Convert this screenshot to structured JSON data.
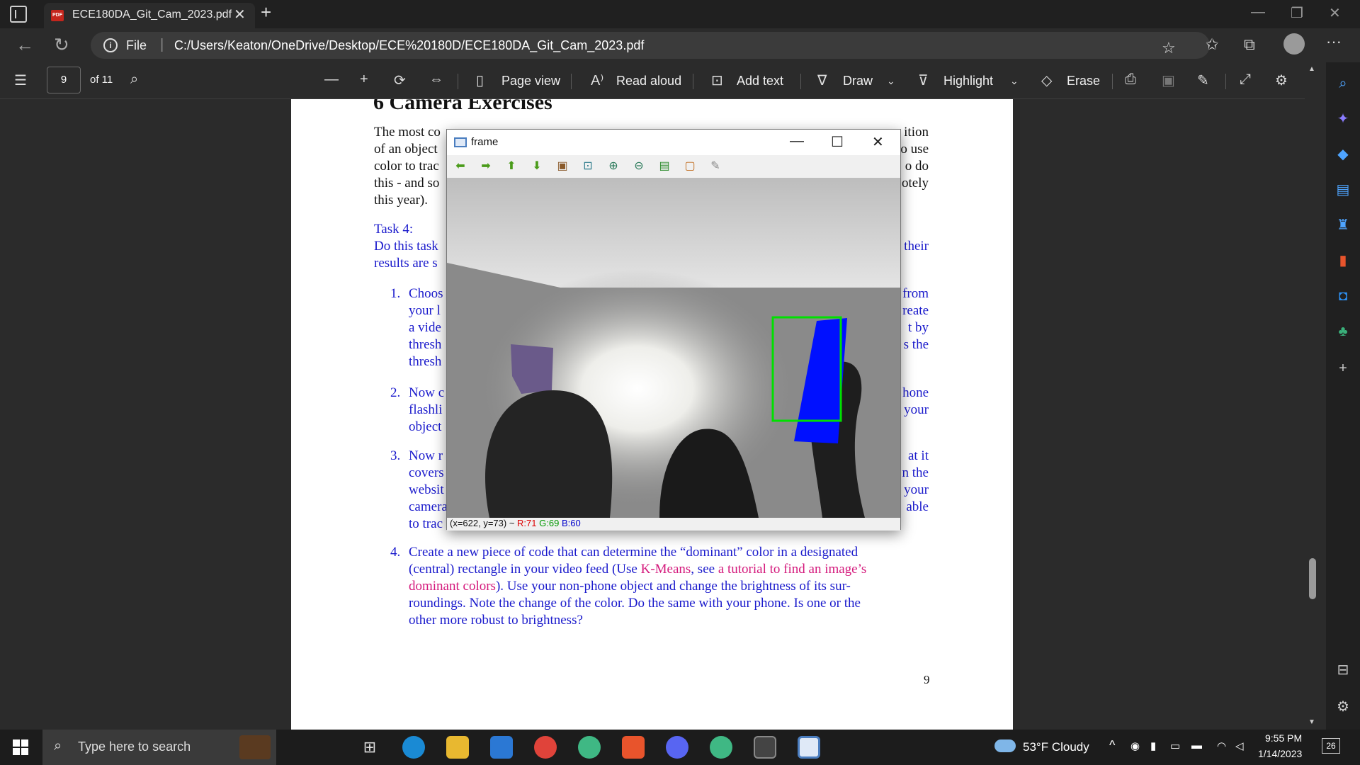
{
  "browser": {
    "tab_title": "ECE180DA_Git_Cam_2023.pdf",
    "pdf_badge": "PDF",
    "file_label": "File",
    "url": "C:/Users/Keaton/OneDrive/Desktop/ECE%20180D/ECE180DA_Git_Cam_2023.pdf"
  },
  "pdf_toolbar": {
    "page_number": "9",
    "page_total": "of 11",
    "page_view": "Page view",
    "read_aloud": "Read aloud",
    "add_text": "Add text",
    "draw": "Draw",
    "highlight": "Highlight",
    "erase": "Erase"
  },
  "pdf_page": {
    "section_title": "6   Camera Exercises",
    "intro_left": [
      "The most co",
      "of an object",
      "color to trac",
      "this - and so",
      "this year)."
    ],
    "intro_right": [
      "ition",
      "o use",
      "o do",
      "otely"
    ],
    "task_label": "Task 4:",
    "task_left": [
      "Do this task",
      "results are s"
    ],
    "task_right": [
      "their"
    ],
    "item1_num": "1.",
    "item1_left": [
      "Choos",
      "your l",
      "a vide",
      "thresh",
      "thresh"
    ],
    "item1_right": [
      "from",
      "reate",
      "t by",
      "s the"
    ],
    "item2_num": "2.",
    "item2_left": [
      "Now c",
      "flashli",
      "object"
    ],
    "item2_right": [
      "hone",
      "your"
    ],
    "item3_num": "3.",
    "item3_left": [
      "Now r",
      "covers",
      "websit",
      "camera",
      "to trac"
    ],
    "item3_right": [
      "at it",
      "n the",
      "your",
      "able"
    ],
    "item4_num": "4.",
    "item4_line1": "Create a new piece of code that can determine the “dominant” color in a designated",
    "item4_line2a": "(central) rectangle in your video feed (Use ",
    "item4_link1": "K-Means",
    "item4_line2b": ", see ",
    "item4_link2": "a tutorial to find an image’s",
    "item4_link3": "dominant colors",
    "item4_line3b": ").  Use your non-phone object and change the brightness of its sur-",
    "item4_line4": "roundings. Note the change of the color. Do the same with your phone. Is one or the",
    "item4_line5": "other more robust to brightness?",
    "page_number": "9"
  },
  "frame_window": {
    "title": "frame",
    "status_coords": "(x=622, y=73) ~ ",
    "status_r": "R:71",
    "status_g": "G:69",
    "status_b": "B:60"
  },
  "taskbar": {
    "search_placeholder": "Type here to search",
    "weather": "53°F  Cloudy",
    "time": "9:55 PM",
    "date": "1/14/2023",
    "notifications": "26"
  },
  "colors": {
    "link_blue": "#1a1acc",
    "link_magenta": "#d4197c",
    "detect_box": "#00e000",
    "phone_blue": "#0010ff"
  }
}
